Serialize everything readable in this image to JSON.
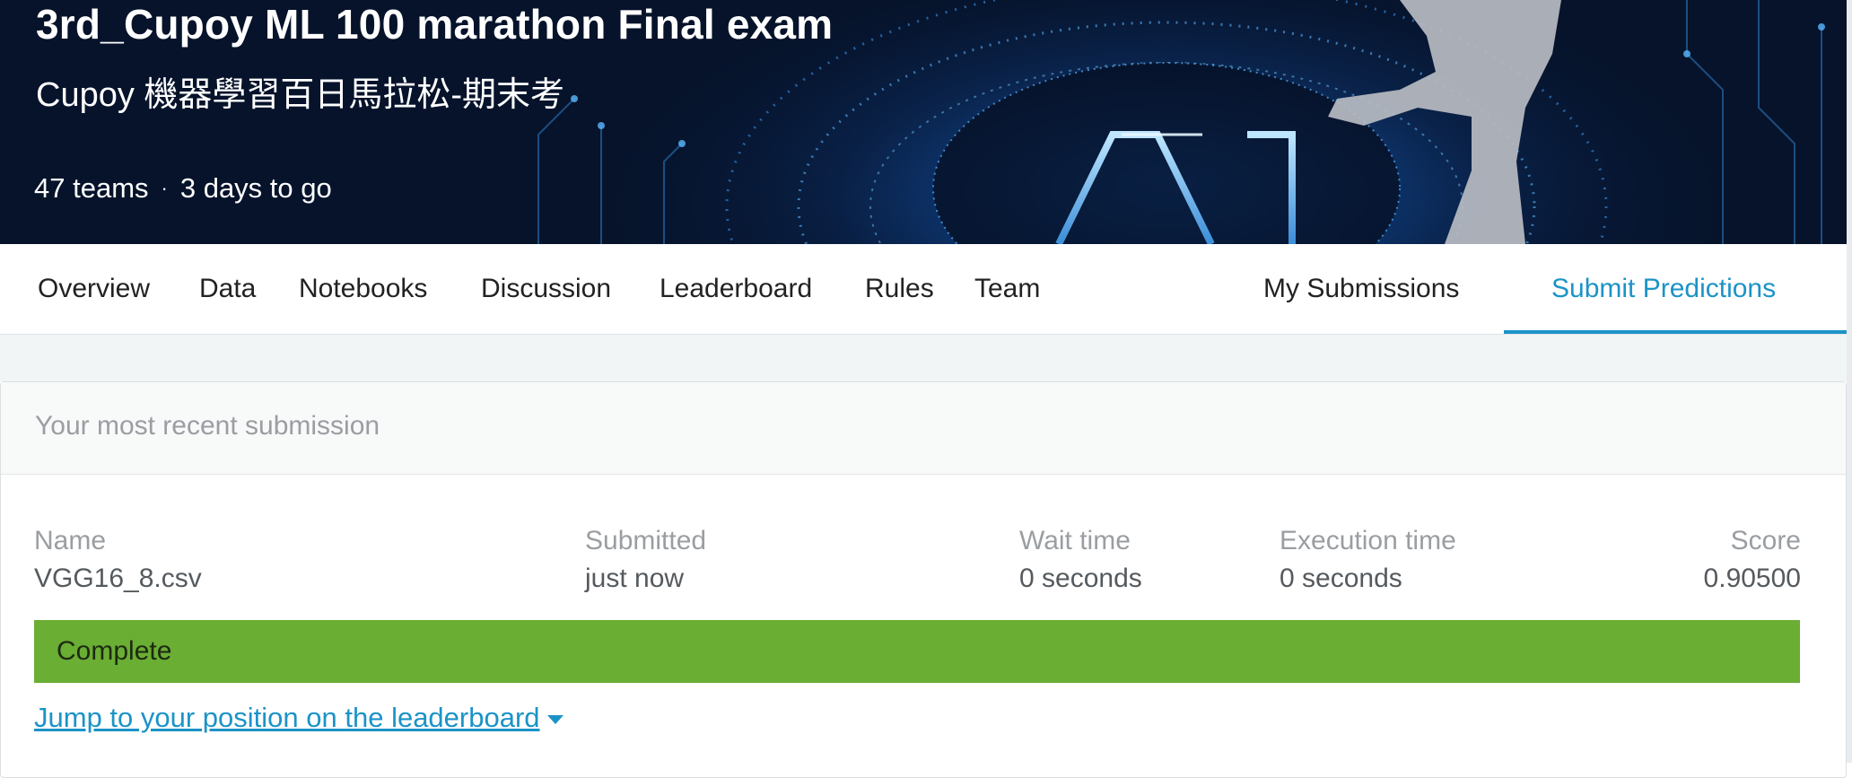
{
  "competition": {
    "title": "3rd_Cupoy ML 100 marathon Final exam",
    "subtitle": "Cupoy 機器學習百日馬拉松-期末考",
    "teams": "47 teams",
    "separator": "·",
    "deadline": "3 days to go",
    "banner_art": "AI"
  },
  "tabs": [
    {
      "label": "Overview"
    },
    {
      "label": "Data"
    },
    {
      "label": "Notebooks"
    },
    {
      "label": "Discussion"
    },
    {
      "label": "Leaderboard"
    },
    {
      "label": "Rules"
    },
    {
      "label": "Team"
    },
    {
      "label": "My Submissions"
    },
    {
      "label": "Submit Predictions",
      "active": true
    }
  ],
  "submission": {
    "header": "Your most recent submission",
    "columns": {
      "name": {
        "label": "Name",
        "value": "VGG16_8.csv"
      },
      "submitted": {
        "label": "Submitted",
        "value": "just now"
      },
      "wait_time": {
        "label": "Wait time",
        "value": "0 seconds"
      },
      "execution_time": {
        "label": "Execution time",
        "value": "0 seconds"
      },
      "score": {
        "label": "Score",
        "value": "0.90500"
      }
    },
    "status": "Complete",
    "jump_link": "Jump to your position on the leaderboard"
  },
  "colors": {
    "accent": "#1c93c7",
    "status_complete": "#6aae34",
    "banner_bg": "#081a3a"
  },
  "icons": {
    "jump_link_icon": "caret-down-icon"
  }
}
